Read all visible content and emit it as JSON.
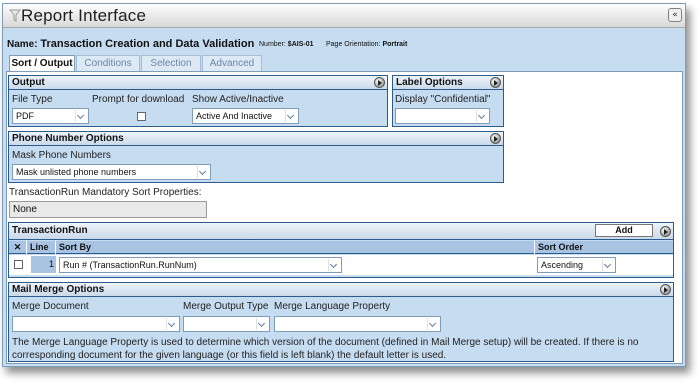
{
  "window": {
    "title": "Report Interface",
    "collapse_glyph": "«"
  },
  "header": {
    "name_label": "Name:",
    "name_value": "Transaction Creation and Data Validation",
    "number_label": "Number:",
    "number_value": "$AIS-01",
    "orientation_label": "Page Orientation:",
    "orientation_value": "Portrait"
  },
  "tabs": [
    {
      "label": "Sort / Output",
      "active": true
    },
    {
      "label": "Conditions",
      "active": false
    },
    {
      "label": "Selection",
      "active": false
    },
    {
      "label": "Advanced",
      "active": false
    }
  ],
  "output": {
    "title": "Output",
    "file_type_label": "File Type",
    "file_type_value": "PDF",
    "prompt_label": "Prompt for download",
    "prompt_checked": false,
    "show_active_label": "Show Active/Inactive",
    "show_active_value": "Active And Inactive"
  },
  "label_options": {
    "title": "Label Options",
    "confidential_label": "Display \"Confidential\"",
    "confidential_value": ""
  },
  "phone_options": {
    "title": "Phone Number Options",
    "mask_label": "Mask Phone Numbers",
    "mask_value": "Mask unlisted phone numbers"
  },
  "mandatory_sort": {
    "label": "TransactionRun Mandatory Sort Properties:",
    "value": "None"
  },
  "transaction_run": {
    "title": "TransactionRun",
    "add_label": "Add",
    "columns": {
      "delete": "✕",
      "line": "Line",
      "sort_by": "Sort By",
      "sort_order": "Sort Order"
    },
    "rows": [
      {
        "line": "1",
        "sort_by": "Run # (TransactionRun.RunNum)",
        "sort_order": "Ascending",
        "checked": false
      }
    ]
  },
  "mail_merge": {
    "title": "Mail Merge Options",
    "merge_document_label": "Merge Document",
    "merge_document_value": "",
    "merge_output_label": "Merge Output Type",
    "merge_output_value": "",
    "merge_language_label": "Merge Language Property",
    "merge_language_value": "",
    "description": "The Merge Language Property is used to determine which version of the document (defined in Mail Merge setup) will be created. If there is no corresponding document for the given language (or this field is left blank) the default letter is used."
  },
  "colors": {
    "panel_background": "#c6dcf1",
    "panel_border": "#2c5c8e",
    "grid_header": "#a9c4e3"
  },
  "icons": {
    "title_icon": "funnel-icon",
    "panel_toggle": "circle-arrow-icon",
    "dropdown": "chevron-down-icon"
  }
}
